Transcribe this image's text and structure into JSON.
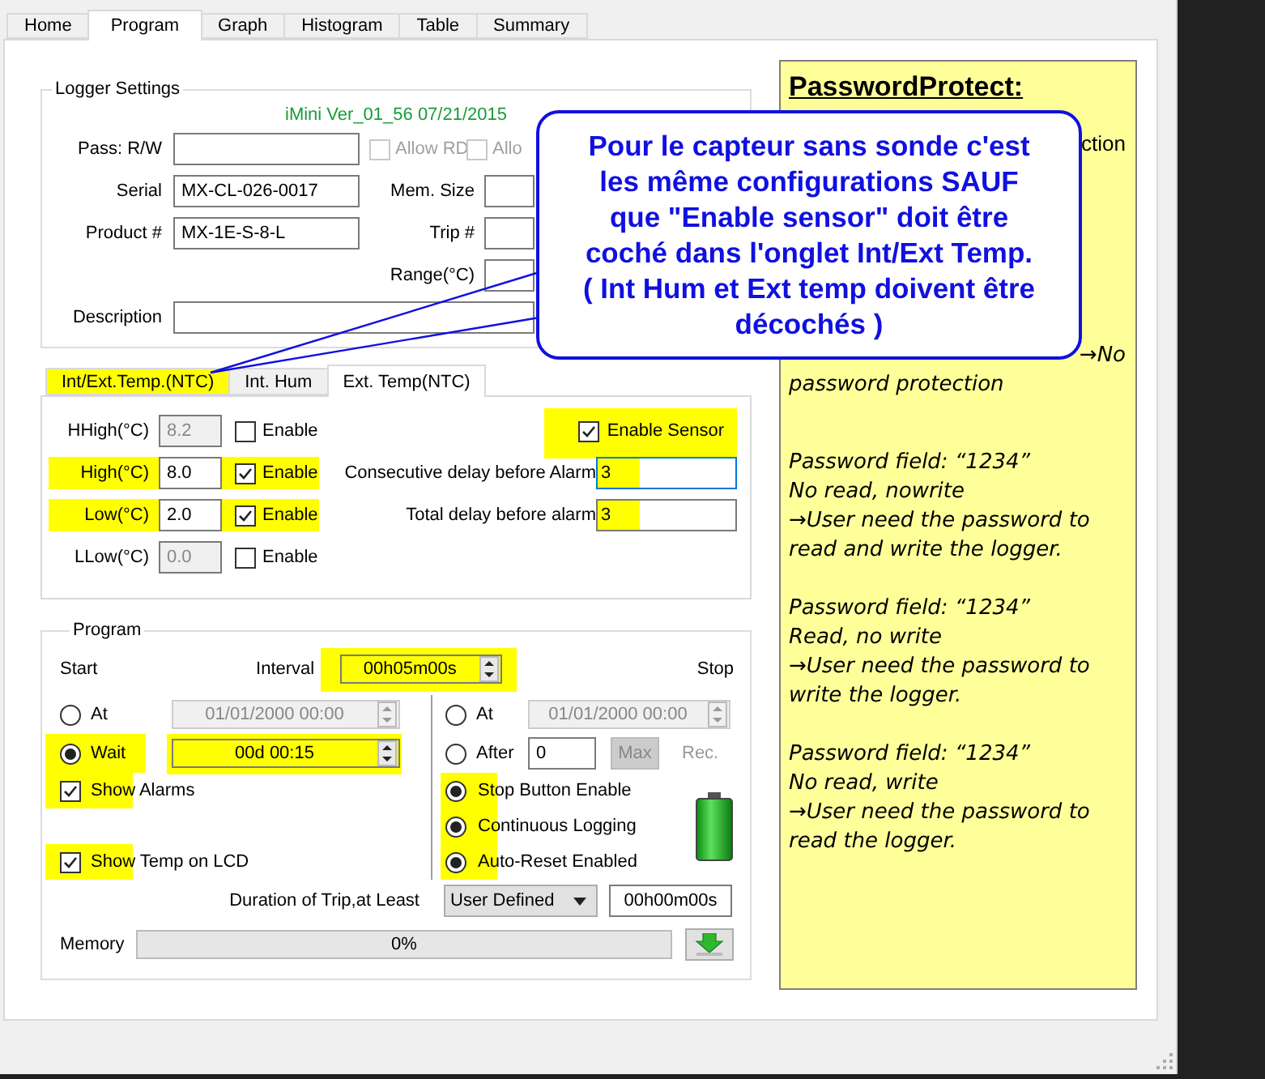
{
  "tabs": [
    {
      "label": "Home",
      "selected": false
    },
    {
      "label": "Program",
      "selected": true
    },
    {
      "label": "Graph",
      "selected": false
    },
    {
      "label": "Histogram",
      "selected": false
    },
    {
      "label": "Table",
      "selected": false
    },
    {
      "label": "Summary",
      "selected": false
    }
  ],
  "logger_settings": {
    "title": "Logger Settings",
    "version": "iMini Ver_01_56 07/21/2015",
    "fields": [
      {
        "label": "Pass: R/W"
      },
      {
        "label": "Serial",
        "value": "MX-CL-026-0017"
      },
      {
        "label": "Product #",
        "value": "MX-1E-S-8-L"
      }
    ],
    "allow": [
      {
        "label": "Allow RD",
        "checked": false
      },
      {
        "label": "Allo",
        "checked": false
      }
    ],
    "right_fields": [
      {
        "label": "Mem. Size"
      },
      {
        "label": "Trip #"
      },
      {
        "label": "Range(°C)"
      }
    ],
    "description": {
      "label": "Description"
    }
  },
  "sensor_tabs": [
    {
      "label": "Int/Ext.Temp.(NTC)",
      "selected": false,
      "highlighted": true
    },
    {
      "label": "Int. Hum",
      "selected": false,
      "highlighted": false
    },
    {
      "label": "Ext. Temp(NTC)",
      "selected": true,
      "highlighted": false
    }
  ],
  "thresholds": [
    {
      "label": "HHigh(°C)",
      "value": "8.2",
      "enable_label": "Enable",
      "checked": false,
      "highlighted": false
    },
    {
      "label": "High(°C)",
      "value": "8.0",
      "enable_label": "Enable",
      "checked": true,
      "highlighted": true
    },
    {
      "label": "Low(°C)",
      "value": "2.0",
      "enable_label": "Enable",
      "checked": true,
      "highlighted": true
    },
    {
      "label": "LLow(°C)",
      "value": "0.0",
      "enable_label": "Enable",
      "checked": false,
      "highlighted": false
    }
  ],
  "enable_sensor": {
    "label": "Enable Sensor",
    "checked": true,
    "highlighted": true
  },
  "delays": [
    {
      "label": "Consecutive delay before Alarm",
      "value": "3",
      "focused": true,
      "highlighted": true
    },
    {
      "label": "Total delay before alarm",
      "value": "3",
      "focused": false,
      "highlighted": true
    }
  ],
  "program": {
    "title": "Program",
    "start_label": "Start",
    "stop_label": "Stop",
    "interval": {
      "label": "Interval",
      "value": "00h05m00s",
      "highlighted": true
    },
    "start": [
      {
        "label": "At",
        "selected": false,
        "value": "01/01/2000 00:00",
        "disabled": true,
        "highlighted": false
      },
      {
        "label": "Wait",
        "selected": true,
        "value": "00d 00:15",
        "disabled": false,
        "highlighted": true
      }
    ],
    "display_options": [
      {
        "label": "Show Alarms",
        "checked": true,
        "highlighted": true
      },
      {
        "label": "Show Temp on LCD",
        "checked": true,
        "highlighted": true
      }
    ],
    "stop": [
      {
        "kind": "date",
        "label": "At",
        "selected": false,
        "value": "01/01/2000 00:00",
        "disabled": true
      },
      {
        "kind": "count",
        "label": "After",
        "selected": false,
        "value": "0",
        "button": "Max",
        "button_disabled": true,
        "unit": "Rec."
      }
    ],
    "stop_options": [
      {
        "label": "Stop Button Enable",
        "selected": true,
        "highlighted": true
      },
      {
        "label": "Continuous Logging",
        "selected": true,
        "highlighted": true
      },
      {
        "label": "Auto-Reset Enabled",
        "selected": true,
        "highlighted": true
      }
    ],
    "duration": {
      "label": "Duration of Trip,at Least",
      "mode": "User Defined",
      "value": "00h00m00s"
    },
    "memory": {
      "label": "Memory",
      "level": 0,
      "reading": "0%"
    }
  },
  "note": {
    "title": "PasswordProtect:",
    "fragment": "ction",
    "partial_tail": "→No",
    "partial_line": "password protection",
    "paragraphs": [
      [
        "Password field: “1234”",
        "No read, nowrite",
        "→User need the password to",
        "read and write the logger."
      ],
      [
        "Password field: “1234”",
        "Read, no write",
        "→User need the password to",
        "write the logger."
      ],
      [
        "Password field: “1234”",
        "No read, write",
        "→User need the password to",
        "read the logger."
      ]
    ]
  },
  "callout": {
    "lines": [
      "Pour le capteur sans sonde c'est",
      "les même configurations SAUF",
      "que \"Enable sensor\" doit être",
      "coché dans l'onglet Int/Ext Temp.",
      "( Int Hum et Ext temp doivent être",
      "décochés )"
    ]
  }
}
